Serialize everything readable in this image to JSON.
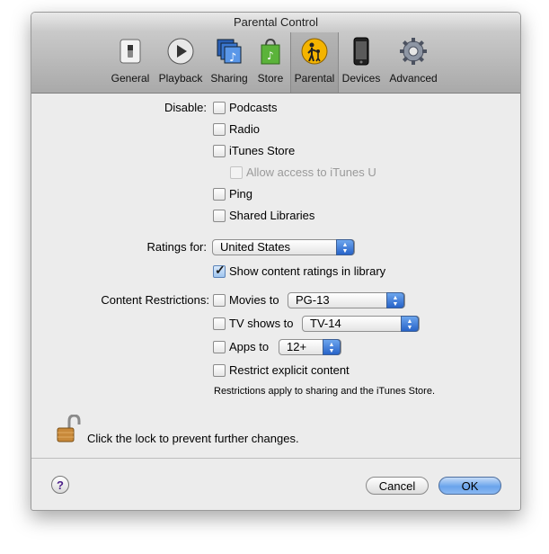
{
  "window": {
    "title": "Parental Control"
  },
  "toolbar": {
    "items": [
      {
        "label": "General",
        "icon": "general-switch-icon"
      },
      {
        "label": "Playback",
        "icon": "playback-icon"
      },
      {
        "label": "Sharing",
        "icon": "sharing-icon"
      },
      {
        "label": "Store",
        "icon": "store-bag-icon"
      },
      {
        "label": "Parental",
        "icon": "parental-icon",
        "selected": true
      },
      {
        "label": "Devices",
        "icon": "iphone-device-icon"
      },
      {
        "label": "Advanced",
        "icon": "advanced-gear-icon"
      }
    ]
  },
  "disable": {
    "label": "Disable:",
    "podcasts": {
      "label": "Podcasts",
      "checked": false
    },
    "radio": {
      "label": "Radio",
      "checked": false
    },
    "itunes_store": {
      "label": "iTunes Store",
      "checked": false
    },
    "itunes_u": {
      "label": "Allow access to iTunes U",
      "checked": false,
      "enabled": false
    },
    "ping": {
      "label": "Ping",
      "checked": false
    },
    "shared_libraries": {
      "label": "Shared Libraries",
      "checked": false
    }
  },
  "ratings": {
    "label": "Ratings for:",
    "country": "United States",
    "show_ratings": {
      "label": "Show content ratings in library",
      "checked": true
    }
  },
  "restrictions": {
    "label": "Content Restrictions:",
    "movies": {
      "label": "Movies to",
      "value": "PG-13",
      "checked": false
    },
    "tv": {
      "label": "TV shows to",
      "value": "TV-14",
      "checked": false
    },
    "apps": {
      "label": "Apps to",
      "value": "12+",
      "checked": false
    },
    "explicit": {
      "label": "Restrict explicit content",
      "checked": false
    },
    "note": "Restrictions apply to sharing and the iTunes Store."
  },
  "lock": {
    "text": "Click the lock to prevent further changes."
  },
  "buttons": {
    "help": "?",
    "cancel": "Cancel",
    "ok": "OK"
  }
}
